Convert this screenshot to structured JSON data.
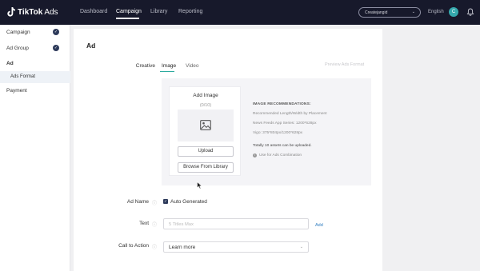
{
  "app": {
    "brand": "TikTok",
    "brand_suffix": "Ads"
  },
  "topnav": {
    "items": [
      {
        "label": "Dashboard",
        "active": false
      },
      {
        "label": "Campaign",
        "active": true
      },
      {
        "label": "Library",
        "active": false
      },
      {
        "label": "Reporting",
        "active": false
      }
    ],
    "account": "Createjangid",
    "language": "English",
    "avatar_initial": "C"
  },
  "sidebar": {
    "items": [
      {
        "label": "Campaign",
        "completed": true
      },
      {
        "label": "Ad Group",
        "completed": true
      },
      {
        "label": "Ad",
        "completed": false
      },
      {
        "label": "Ads Format",
        "completed": false,
        "selected": true
      },
      {
        "label": "Payment",
        "completed": false
      }
    ]
  },
  "main": {
    "title": "Ad",
    "creative": {
      "label": "Creative",
      "tabs": [
        {
          "label": "Image",
          "active": true
        },
        {
          "label": "Video",
          "active": false
        }
      ],
      "preview_link": "Preview Ads Format"
    },
    "upload": {
      "title": "Add Image",
      "count": "(0/10)",
      "upload_button": "Upload",
      "browse_button": "Browse From Library"
    },
    "recommendations": {
      "heading": "IMAGE RECOMMENDATIONS:",
      "line1": "Recommended Length/Width by Placement",
      "line2": "News Feeds App Series: 1200*628px",
      "line3": "Vigo: 375*804px/1200*628px",
      "total": "Totally 10 assets can be uploaded.",
      "combination": "Use for Ads Combination"
    },
    "ad_name": {
      "label": "Ad Name",
      "checkbox_label": "Auto Generated",
      "checked": true
    },
    "text": {
      "label": "Text",
      "placeholder": "5 Titles Max",
      "add_link": "Add"
    },
    "cta": {
      "label": "Call to Action",
      "value": "Learn more"
    }
  },
  "colors": {
    "topbar": "#17192b",
    "accent": "#2aa99e",
    "check": "#2d3a5a",
    "link": "#2d7bbf"
  }
}
